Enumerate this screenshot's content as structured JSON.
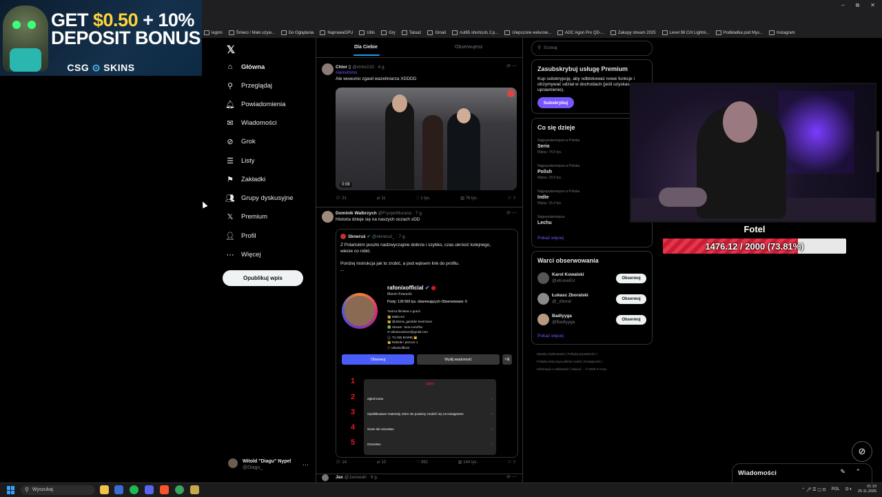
{
  "browser": {
    "bookmarks": [
      "legimi",
      "Śmieci / Mało używ...",
      "Do Oglądania",
      "NaprawaGPU",
      "Utils",
      "Gry",
      "Tatuaż",
      "Gmail",
      "nut65 shortcuts 2.p...",
      "Ulepszone welurow...",
      "AOC Agon Pro QD-...",
      "Zakupy stream 2025",
      "Level 98 Crit Lightni...",
      "Podkładka pod Mys...",
      "Instagram"
    ],
    "window_controls": [
      "–",
      "⧉",
      "✕"
    ]
  },
  "ad": {
    "line1_a": "GET ",
    "line1_b": "$0.50",
    "line1_c": " + 10%",
    "line2": "DEPOSIT BONUS",
    "brand_a": "CSG",
    "brand_o": "⊙",
    "brand_b": "SKINS"
  },
  "nav": {
    "logo": "𝕏",
    "items": [
      {
        "icon": "⌂",
        "label": "Główna"
      },
      {
        "icon": "⚲",
        "label": "Przeglądaj"
      },
      {
        "icon": "🔔︎",
        "label": "Powiadomienia"
      },
      {
        "icon": "✉",
        "label": "Wiadomości"
      },
      {
        "icon": "⊘",
        "label": "Grok"
      },
      {
        "icon": "☰",
        "label": "Listy"
      },
      {
        "icon": "⚑",
        "label": "Zakładki"
      },
      {
        "icon": "👥︎",
        "label": "Grupy dyskusyjne"
      },
      {
        "icon": "𝕏",
        "label": "Premium"
      },
      {
        "icon": "👤︎",
        "label": "Profil"
      },
      {
        "icon": "⋯",
        "label": "Więcej"
      }
    ],
    "post_button": "Opublikuj wpis",
    "user": {
      "name": "Witold \"Diagu\" Nypel",
      "handle": "@Diagu_",
      "more": "⋯"
    }
  },
  "timeline": {
    "tabs": [
      "Dla Ciebie",
      "Obserwujesz"
    ],
    "tweet1": {
      "name": "Chlor",
      "handle": "@chlor215 · 4 g.",
      "tag": "#ainsimmo",
      "text": "Ale wuwunio zgasił wazeliniarza XDDDD",
      "video_time": "0:08",
      "actions": {
        "reply": "21",
        "retweet": "11",
        "like": "1 tys.",
        "views": "76 tys."
      }
    },
    "tweet2": {
      "name": "Dominik Walbrzych",
      "handle": "@FryzjerMurana · 7 g.",
      "text": "Historia dzieje się na naszych oczach xDD",
      "quote": {
        "name": "Skneruś",
        "handle": "@skneruś_ · 7 g.",
        "line1": "Z Polańskim poszło nadzwyczajnie dobrze i szybko, czas ukrócić kolejnego,",
        "line2": "wiecie co robić.",
        "line3": "Poniżej instrukcja jak to zrobić, a pod wpisem link do profilu.",
        "line4": "..."
      },
      "instagram": {
        "username": "rafonixofficial",
        "name": "Marcin Krasucki",
        "stats": "Posty: 126    565 tys. obserwujących    Obserwowane: 6",
        "bio": [
          "Twórca filmików o grach",
          "👑 Mafia sm",
          "👑 @rafonix_gambler kesit boss",
          "🟢 Stream : kick.com/rfnx",
          "✉ rafonixcasinos@gmail.com",
          "🗣 TU SIĘ BAWIĘ 👑",
          "👑 Rafonki i jeszcze 1",
          "ⓘ rafonixofficial"
        ],
        "follow": "Obserwuj",
        "message": "Wyślij wiadomość",
        "add": "+&",
        "menu_title": "Zgłoś",
        "menu": [
          "Zgłoś konto",
          "Opublikowane materiały, które nie powinny znaleźć się na Instagramie",
          "Scam lub oszustwo",
          "Oszustwo"
        ],
        "numbers": [
          "1",
          "2",
          "3",
          "4",
          "5"
        ]
      },
      "actions": {
        "reply": "14",
        "retweet": "10",
        "like": "962",
        "views": "144 tys."
      }
    },
    "tweet3": {
      "name": "Jax",
      "handle": "@Jaxweah · 9 g."
    }
  },
  "sidebar": {
    "search_placeholder": "Szukaj",
    "premium": {
      "title": "Zasubskrybuj usługę Premium",
      "desc": "Kup subskrypcję, aby odblokować nowe funkcje i otrzymywać udział w dochodach (jeśli uzyskasz uprawnienie).",
      "button": "Subskrybuj"
    },
    "trends": {
      "title": "Co się dzieje",
      "items": [
        {
          "ctx": "Najpopularniejsze w Polska",
          "name": "Serio",
          "count": "Wpisy: 74,5 tys."
        },
        {
          "ctx": "Najpopularniejsze w Polska",
          "name": "Polish",
          "count": "Wpisy: 23,9 tys."
        },
        {
          "ctx": "Najpopularniejsze w Polska",
          "name": "Indie",
          "count": "Wpisy: 15,4 tys."
        },
        {
          "ctx": "Najpopularniejsze",
          "name": "Lechu",
          "count": ""
        }
      ],
      "more": "Pokaż więcej"
    },
    "follow": {
      "title": "Warci obserwowania",
      "items": [
        {
          "name": "Karol Kowalski",
          "handle": "@xKoneErr",
          "btn": "Obserwuj"
        },
        {
          "name": "Łukasz Zboralski",
          "handle": "@_zboral",
          "btn": "Obserwuj"
        },
        {
          "name": "Badlyyga",
          "handle": "@Badlyyga",
          "btn": "Obserwuj"
        }
      ],
      "more": "Pokaż więcej"
    },
    "footer": [
      "Zasady użytkowania",
      "Polityka prywatności",
      "Polityka dotycząca plików cookie",
      "Dostępność",
      "Informacje o reklamach",
      "Więcej ···",
      "© 2025 X Corp."
    ]
  },
  "stream_overlay": {
    "goal_title": "Fotel",
    "goal_text": "1476.12 / 2000 (73.81%)",
    "goal_fraction": 0.7381
  },
  "messages_dock": {
    "title": "Wiadomości",
    "icons": "✎ ⌃"
  },
  "grok_fab": "⊘",
  "taskbar": {
    "search": "Wyszukaj",
    "lang": "POL",
    "time": "01:19",
    "date": "25.11.2025"
  }
}
